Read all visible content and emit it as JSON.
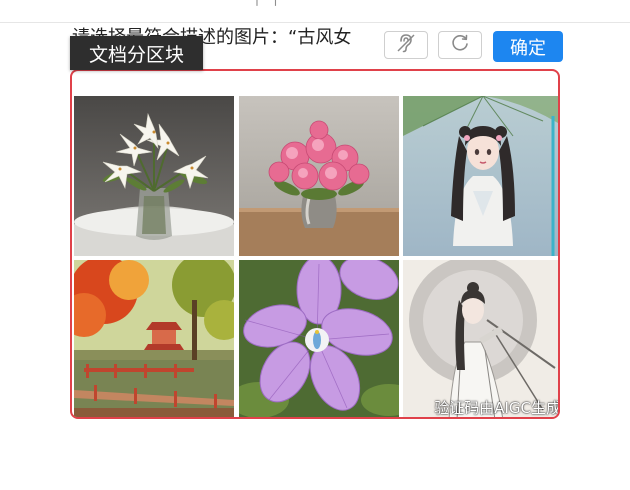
{
  "overlay": {
    "label": "文档分区块"
  },
  "captcha": {
    "instruction": "请选择最符合描述的图片：“古风女",
    "top_fragment": "个 个",
    "audio_icon": "hearing-accessibility-icon",
    "refresh_icon": "refresh-icon",
    "confirm_label": "确定",
    "aigc_note": "验证码由AIGC生成",
    "colors": {
      "confirm": "#1d86f0",
      "frame_border": "#e0414a"
    },
    "tiles": [
      {
        "name": "white-lilies-vase"
      },
      {
        "name": "pink-carnations-vase"
      },
      {
        "name": "ancient-style-girl-umbrella"
      },
      {
        "name": "autumn-pavilion-lake"
      },
      {
        "name": "purple-flower-closeup"
      },
      {
        "name": "ancient-style-woman-sketch"
      }
    ]
  }
}
